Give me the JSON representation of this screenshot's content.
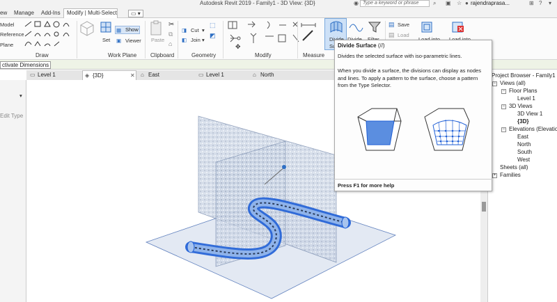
{
  "app": {
    "title": "Autodesk Revit 2019 - Family1 - 3D View: {3D}",
    "search_placeholder": "Type a keyword or phrase",
    "user": "rajendraprasa..."
  },
  "menu": [
    "ew",
    "Manage",
    "Add-Ins",
    "Modify | Multi-Select"
  ],
  "ribbon": {
    "draw_labels": [
      "Model",
      "Reference",
      "Plane"
    ],
    "panels": [
      "Draw",
      "Work Plane",
      "Clipboard",
      "Geometry",
      "Modify",
      "Measure"
    ],
    "work_plane": {
      "set": "Set",
      "show": "Show",
      "viewer": "Viewer"
    },
    "clipboard": {
      "paste": "Paste"
    },
    "geometry": {
      "cut": "Cut",
      "join": "Join"
    },
    "create": {
      "divide": "Divide",
      "divide_short": "Su",
      "divide_path": "Divide",
      "filter": "Filter"
    },
    "save": {
      "save": "Save",
      "load": "Load"
    },
    "load_into": [
      "Load into",
      "Load into"
    ]
  },
  "options_bar": {
    "label": "ctivate Dimensions"
  },
  "view_tabs": [
    {
      "label": "Level 1",
      "active": false
    },
    {
      "label": "{3D}",
      "active": true
    },
    {
      "label": "East",
      "active": false
    },
    {
      "label": "Level 1",
      "active": false
    },
    {
      "label": "North",
      "active": false
    }
  ],
  "left_panel": {
    "edit_type": "Edit Type"
  },
  "tooltip": {
    "title": "Divide Surface",
    "shortcut": "(//)",
    "desc": "Divides the selected surface with iso-parametric lines.",
    "body": "When you divide a surface, the divisions can display as nodes and lines. To apply a pattern to the surface, choose a pattern from the Type Selector.",
    "help": "Press F1 for more help"
  },
  "project_browser": {
    "title": "Project Browser - Family1",
    "items": [
      {
        "label": "Views (all)",
        "level": 0,
        "toggle": "-"
      },
      {
        "label": "Floor Plans",
        "level": 1,
        "toggle": "-"
      },
      {
        "label": "Level 1",
        "level": 2,
        "toggle": ""
      },
      {
        "label": "3D Views",
        "level": 1,
        "toggle": "-"
      },
      {
        "label": "3D View 1",
        "level": 2,
        "toggle": ""
      },
      {
        "label": "{3D}",
        "level": 2,
        "toggle": "",
        "bold": true
      },
      {
        "label": "Elevations (Elevation",
        "level": 1,
        "toggle": "-"
      },
      {
        "label": "East",
        "level": 2,
        "toggle": ""
      },
      {
        "label": "North",
        "level": 2,
        "toggle": ""
      },
      {
        "label": "South",
        "level": 2,
        "toggle": ""
      },
      {
        "label": "West",
        "level": 2,
        "toggle": ""
      },
      {
        "label": "Sheets (all)",
        "level": 0,
        "toggle": ""
      },
      {
        "label": "Families",
        "level": 0,
        "toggle": "+"
      }
    ]
  },
  "colors": {
    "accent": "#3b78d8",
    "selection": "#1f5fd6",
    "ribbon_active": "#cde1f7"
  }
}
